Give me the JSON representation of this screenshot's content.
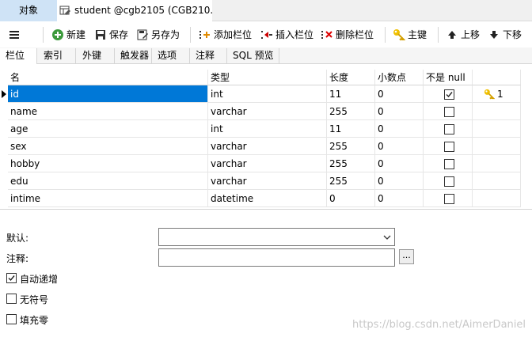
{
  "window_tabs": {
    "objects": "对象",
    "table": "student @cgb2105 (CGB210..."
  },
  "toolbar": {
    "new": "新建",
    "save": "保存",
    "save_as": "另存为",
    "add_column": "添加栏位",
    "insert_column": "插入栏位",
    "delete_column": "删除栏位",
    "primary_key": "主键",
    "move_up": "上移",
    "move_down": "下移"
  },
  "tabs": [
    "栏位",
    "索引",
    "外键",
    "触发器",
    "选项",
    "注释",
    "SQL 预览"
  ],
  "columns_header": [
    "名",
    "类型",
    "长度",
    "小数点",
    "不是 null",
    ""
  ],
  "rows": [
    {
      "name": "id",
      "type": "int",
      "length": "11",
      "decimals": "0",
      "not_null": true,
      "key": "1"
    },
    {
      "name": "name",
      "type": "varchar",
      "length": "255",
      "decimals": "0",
      "not_null": false,
      "key": ""
    },
    {
      "name": "age",
      "type": "int",
      "length": "11",
      "decimals": "0",
      "not_null": false,
      "key": ""
    },
    {
      "name": "sex",
      "type": "varchar",
      "length": "255",
      "decimals": "0",
      "not_null": false,
      "key": ""
    },
    {
      "name": "hobby",
      "type": "varchar",
      "length": "255",
      "decimals": "0",
      "not_null": false,
      "key": ""
    },
    {
      "name": "edu",
      "type": "varchar",
      "length": "255",
      "decimals": "0",
      "not_null": false,
      "key": ""
    },
    {
      "name": "intime",
      "type": "datetime",
      "length": "0",
      "decimals": "0",
      "not_null": false,
      "key": ""
    }
  ],
  "form": {
    "default_label": "默认:",
    "comment_label": "注释:",
    "browse_button": "...",
    "auto_increment": {
      "label": "自动递增",
      "checked": true
    },
    "unsigned": {
      "label": "无符号",
      "checked": false
    },
    "zerofill": {
      "label": "填充零",
      "checked": false
    }
  },
  "watermark": "https://blog.csdn.net/AimerDaniel",
  "colors": {
    "selection": "#0078d7",
    "tab_active": "#cfe3f6"
  }
}
